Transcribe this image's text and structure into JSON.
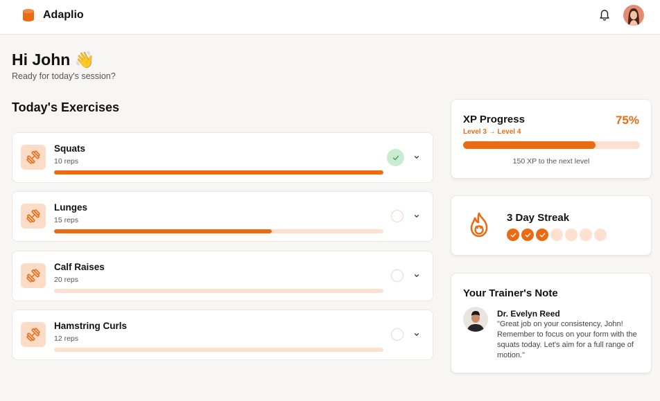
{
  "app": {
    "brand": "Adaplio"
  },
  "greeting": {
    "title": "Hi John 👋",
    "subtitle": "Ready for today's session?"
  },
  "exercises": {
    "title": "Today's Exercises",
    "items": [
      {
        "name": "Squats",
        "reps": "10 reps",
        "progress": 1.0,
        "completed": true
      },
      {
        "name": "Lunges",
        "reps": "15 reps",
        "progress": 0.66,
        "completed": false
      },
      {
        "name": "Calf Raises",
        "reps": "20 reps",
        "progress": 0,
        "completed": false
      },
      {
        "name": "Hamstring Curls",
        "reps": "12 reps",
        "progress": 0,
        "completed": false
      }
    ]
  },
  "xp": {
    "title": "XP Progress",
    "percent_label": "75%",
    "percent": 75,
    "level_label": "Level 3 → Level 4",
    "next_label": "150 XP to the next level"
  },
  "streak": {
    "title": "3 Day Streak",
    "days_completed": 3,
    "days_total": 7
  },
  "trainer_note": {
    "title": "Your Trainer's Note",
    "name": "Dr. Evelyn Reed",
    "message": "\"Great job on your consistency, John! Remember to focus on your form with the squats today. Let's aim for a full range of motion.\""
  },
  "colors": {
    "accent": "#ea6b12",
    "accent_light": "#fde0cf",
    "success_bg": "#c9ecd0",
    "success": "#3aa25a"
  },
  "icons": {
    "logo": "database-logo-icon",
    "bell": "bell-icon",
    "exercise": "dumbbell-icon",
    "expand": "chevron-down-icon",
    "streak": "flame-icon"
  }
}
